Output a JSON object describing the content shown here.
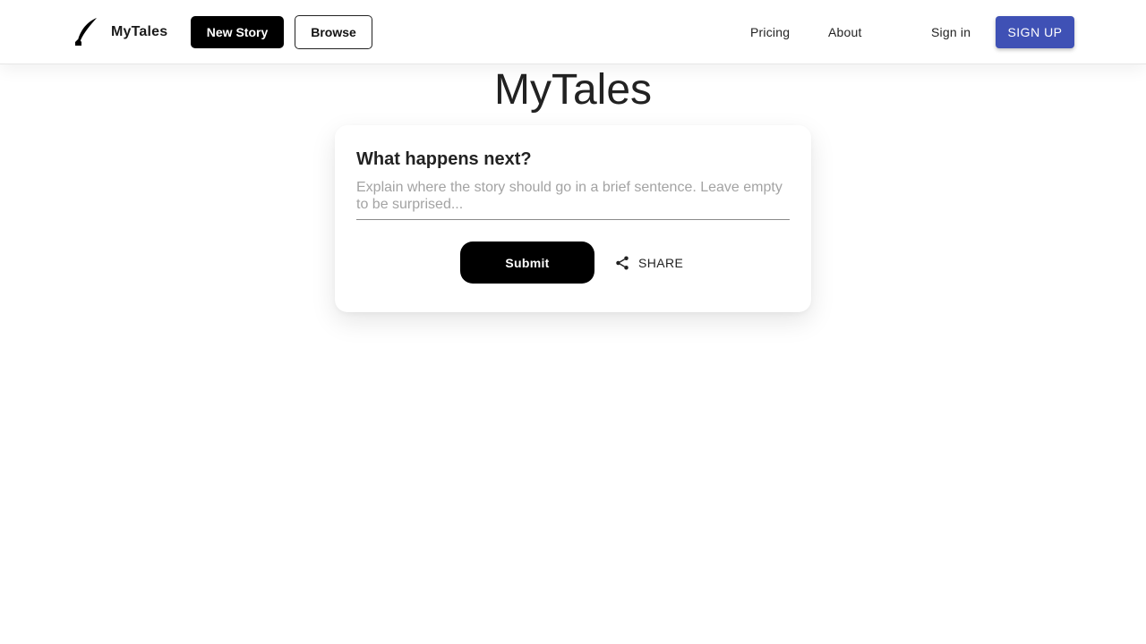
{
  "header": {
    "brand_name": "MyTales",
    "brand_icon": "quill-pen-icon",
    "new_story_label": "New Story",
    "browse_label": "Browse",
    "nav": {
      "pricing": "Pricing",
      "about": "About",
      "sign_in": "Sign in"
    },
    "sign_up_label": "SIGN UP"
  },
  "main": {
    "title": "MyTales",
    "prompt_card": {
      "heading": "What happens next?",
      "input_value": "",
      "input_placeholder": "Explain where the story should go in a brief sentence. Leave empty to be surprised...",
      "submit_label": "Submit",
      "share_label": "SHARE",
      "share_icon": "share-icon"
    }
  },
  "colors": {
    "primary_black": "#000000",
    "sign_up_blue": "#3f51b5",
    "text": "#222222",
    "placeholder": "#a3a3a3"
  }
}
